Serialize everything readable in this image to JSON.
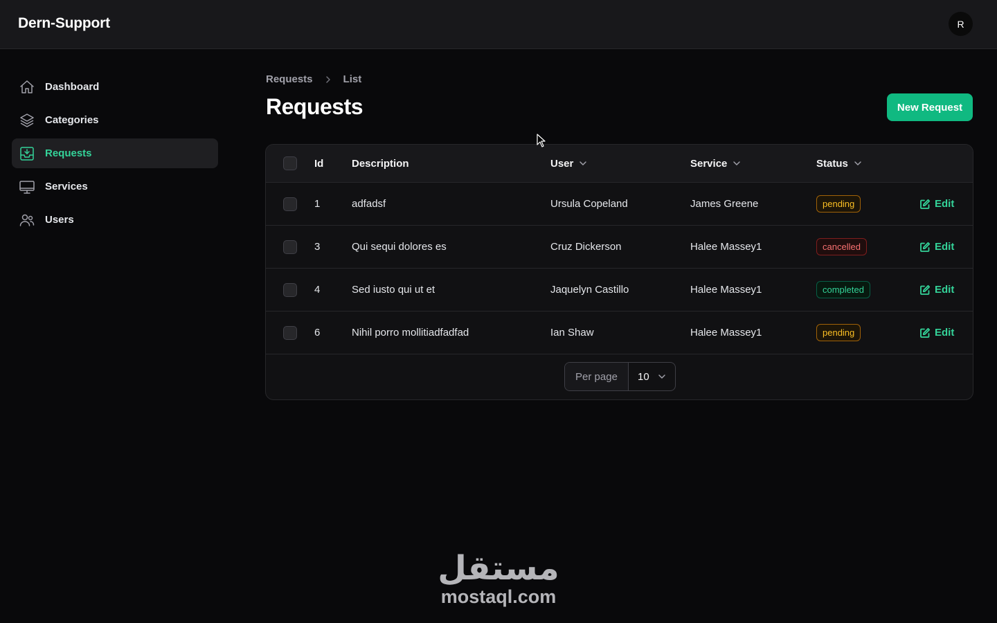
{
  "app": {
    "brand": "Dern-Support",
    "avatar_initial": "R"
  },
  "sidebar": {
    "items": [
      {
        "label": "Dashboard",
        "icon": "home-icon",
        "active": false
      },
      {
        "label": "Categories",
        "icon": "layers-icon",
        "active": false
      },
      {
        "label": "Requests",
        "icon": "inbox-icon",
        "active": true
      },
      {
        "label": "Services",
        "icon": "monitor-icon",
        "active": false
      },
      {
        "label": "Users",
        "icon": "users-icon",
        "active": false
      }
    ]
  },
  "breadcrumb": {
    "parent": "Requests",
    "current": "List"
  },
  "page": {
    "title": "Requests",
    "new_button": "New Request"
  },
  "table": {
    "headers": {
      "id": "Id",
      "description": "Description",
      "user": "User",
      "service": "Service",
      "status": "Status"
    },
    "rows": [
      {
        "id": "1",
        "description": "adfadsf",
        "user": "Ursula Copeland",
        "service": "James Greene",
        "status": "pending",
        "action": "Edit"
      },
      {
        "id": "3",
        "description": "Qui sequi dolores es",
        "user": "Cruz Dickerson",
        "service": "Halee Massey1",
        "status": "cancelled",
        "action": "Edit"
      },
      {
        "id": "4",
        "description": "Sed iusto qui ut et",
        "user": "Jaquelyn Castillo",
        "service": "Halee Massey1",
        "status": "completed",
        "action": "Edit"
      },
      {
        "id": "6",
        "description": "Nihil porro mollitiadfadfad",
        "user": "Ian Shaw",
        "service": "Halee Massey1",
        "status": "pending",
        "action": "Edit"
      }
    ]
  },
  "pagination": {
    "per_page_label": "Per page",
    "per_page_value": "10"
  },
  "watermark": {
    "arabic": "مستقل",
    "latin": "mostaql.com"
  },
  "colors": {
    "accent": "#10b981",
    "accent_text": "#34d399",
    "background": "#09090b",
    "pending": "#fbbf24",
    "cancelled": "#f87171",
    "completed": "#34d399"
  }
}
